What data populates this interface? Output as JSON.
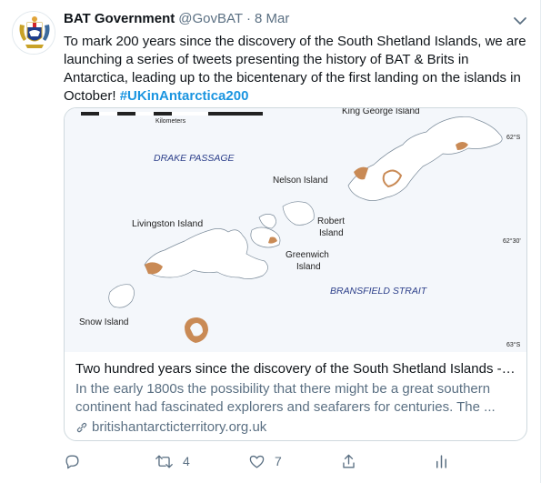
{
  "tweet": {
    "author_name": "BAT Government",
    "handle": "@GovBAT",
    "separator": "·",
    "date": "8 Mar",
    "text_main": "To mark 200 years since the discovery of the South Shetland Islands, we are launching a series of tweets presenting the history of BAT & Brits in Antarctica, leading up to the bicentenary of the first landing on the islands in October! ",
    "hashtag": "#UKinAntarctica200"
  },
  "card": {
    "title": "Two hundred years since the discovery of the South Shetland Islands - B...",
    "description": "In the early 1800s the possibility that there might be a great southern continent had fascinated explorers and seafarers for centuries. The ...",
    "domain": "britishantarcticterritory.org.uk",
    "map": {
      "scale_label": "Kilometers",
      "labels": {
        "king_george": "King George Island",
        "drake": "DRAKE PASSAGE",
        "nelson": "Nelson Island",
        "livingston": "Livingston Island",
        "robert_1": "Robert",
        "robert_2": "Island",
        "greenwich_1": "Greenwich",
        "greenwich_2": "Island",
        "bransfield": "BRANSFIELD STRAIT",
        "snow": "Snow Island",
        "lat_62": "62°S",
        "lat_6230": "62°30'",
        "lat_63": "63°S"
      }
    }
  },
  "actions": {
    "reply_count": "",
    "retweet_count": "4",
    "like_count": "7"
  },
  "colors": {
    "accent": "#1da1f2",
    "hashtag": "#1b95e0",
    "muted": "#5b7083",
    "land": "#ffffff",
    "exposed_rock": "#c98a55",
    "sea": "#f4f7fb"
  },
  "icons": [
    "avatar-crest-icon",
    "chevron-down-icon",
    "link-icon",
    "reply-icon",
    "retweet-icon",
    "like-icon",
    "share-icon",
    "analytics-icon"
  ]
}
